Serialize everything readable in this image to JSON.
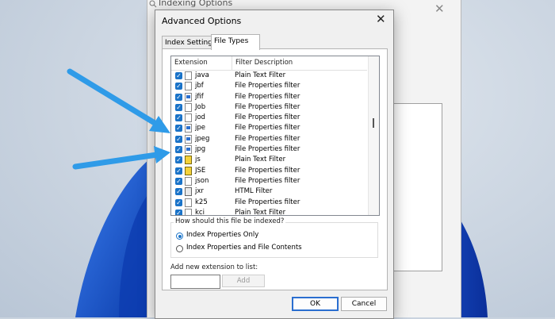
{
  "background_window": {
    "title": "Indexing Options",
    "close_glyph": "✕"
  },
  "dialog": {
    "title": "Advanced Options",
    "close_glyph": "✕",
    "tabs": [
      {
        "label": "Index Settings",
        "active": false
      },
      {
        "label": "File Types",
        "active": true
      }
    ],
    "list": {
      "columns": [
        "Extension",
        "Filter Description"
      ],
      "rows": [
        {
          "ext": "java",
          "desc": "Plain Text Filter",
          "checked": true,
          "icon": "file-icon"
        },
        {
          "ext": "jbf",
          "desc": "File Properties filter",
          "checked": true,
          "icon": "file-icon"
        },
        {
          "ext": "jfif",
          "desc": "File Properties filter",
          "checked": true,
          "icon": "image-file-icon"
        },
        {
          "ext": "Job",
          "desc": "File Properties filter",
          "checked": true,
          "icon": "file-icon"
        },
        {
          "ext": "jod",
          "desc": "File Properties filter",
          "checked": true,
          "icon": "file-icon"
        },
        {
          "ext": "jpe",
          "desc": "File Properties filter",
          "checked": true,
          "icon": "image-file-icon"
        },
        {
          "ext": "jpeg",
          "desc": "File Properties filter",
          "checked": true,
          "icon": "image-file-icon"
        },
        {
          "ext": "jpg",
          "desc": "File Properties filter",
          "checked": true,
          "icon": "image-file-icon"
        },
        {
          "ext": "js",
          "desc": "Plain Text Filter",
          "checked": true,
          "icon": "script-file-icon"
        },
        {
          "ext": "JSE",
          "desc": "File Properties filter",
          "checked": true,
          "icon": "script-file-icon"
        },
        {
          "ext": "json",
          "desc": "File Properties filter",
          "checked": true,
          "icon": "file-icon"
        },
        {
          "ext": "jxr",
          "desc": "HTML Filter",
          "checked": true,
          "icon": "html-file-icon"
        },
        {
          "ext": "k25",
          "desc": "File Properties filter",
          "checked": true,
          "icon": "file-icon"
        },
        {
          "ext": "kci",
          "desc": "Plain Text Filter",
          "checked": true,
          "icon": "file-icon"
        }
      ]
    },
    "index_group": {
      "label": "How should this file be indexed?",
      "options": [
        {
          "label": "Index Properties Only",
          "selected": true
        },
        {
          "label": "Index Properties and File Contents",
          "selected": false
        }
      ]
    },
    "add_extension": {
      "label": "Add new extension to list:",
      "value": "",
      "button": "Add"
    },
    "buttons": {
      "ok": "OK",
      "cancel": "Cancel"
    }
  },
  "colors": {
    "accent": "#1a73c8",
    "arrow": "#2f9be8"
  }
}
